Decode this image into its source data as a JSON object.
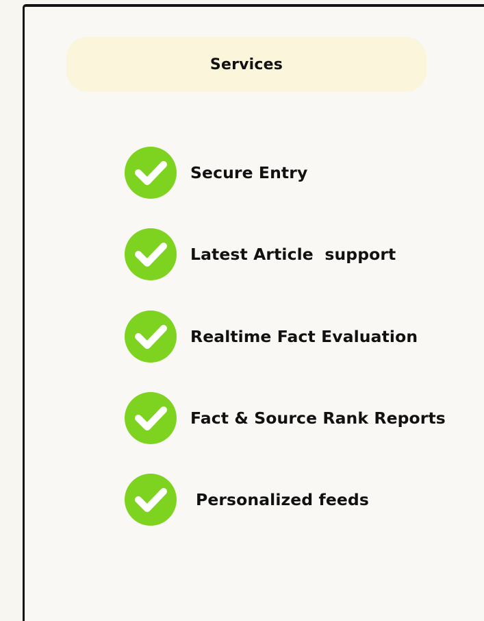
{
  "header": {
    "title": "Services"
  },
  "services": {
    "items": [
      {
        "label": "Secure Entry",
        "icon": "check-circle-icon"
      },
      {
        "label": "Latest Article  support",
        "icon": "check-circle-icon"
      },
      {
        "label": "Realtime Fact Evaluation",
        "icon": "check-circle-icon"
      },
      {
        "label": "Fact & Source Rank Reports",
        "icon": "check-circle-icon"
      },
      {
        "label": "Personalized feeds",
        "icon": "check-circle-icon"
      }
    ]
  },
  "colors": {
    "background": "#f8f6f1",
    "header_pill": "#fbf5db",
    "check_green": "#7ed321",
    "text": "#111111",
    "frame": "#141414"
  }
}
